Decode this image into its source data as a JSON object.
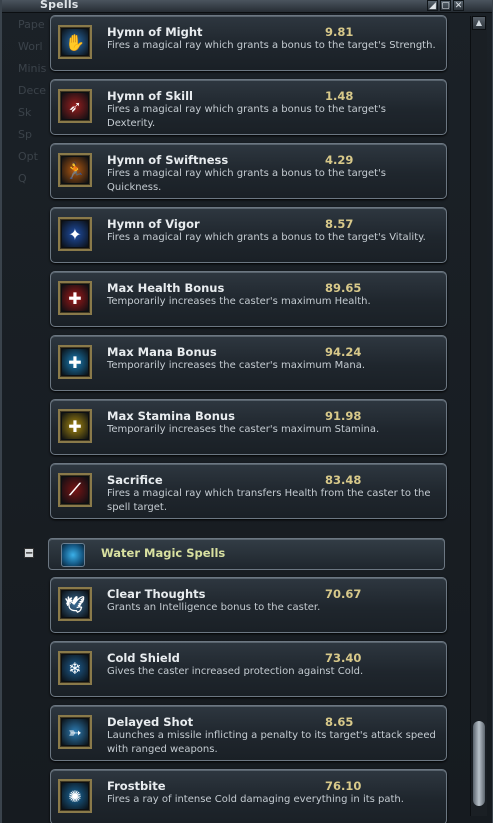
{
  "window": {
    "title": "Spells",
    "buttons": [
      "◢",
      "▢",
      "✕"
    ]
  },
  "background_panel": {
    "items": [
      "Pape",
      "Worl",
      "Minis",
      "Dece",
      "Sk",
      "Sp",
      "Opt",
      "Q"
    ]
  },
  "spells_top": [
    {
      "name": "Hymn of Might",
      "value": "9.81",
      "desc": "Fires a magical ray which grants a bonus to the target's Strength.",
      "icon": "might-icon",
      "icon_color": "#2a6fb0"
    },
    {
      "name": "Hymn of Skill",
      "value": "1.48",
      "desc": "Fires a magical ray which grants a bonus to the target's Dexterity.",
      "icon": "skill-icon",
      "icon_color": "#9a1f1f"
    },
    {
      "name": "Hymn of Swiftness",
      "value": "4.29",
      "desc": "Fires a magical ray which grants a bonus to the target's Quickness.",
      "icon": "swiftness-icon",
      "icon_color": "#b55a12"
    },
    {
      "name": "Hymn of Vigor",
      "value": "8.57",
      "desc": "Fires a magical ray which grants a bonus to the target's Vitality.",
      "icon": "vigor-icon",
      "icon_color": "#1f4fa8"
    },
    {
      "name": "Max Health Bonus",
      "value": "89.65",
      "desc": "Temporarily increases the caster's maximum Health.",
      "icon": "health-icon",
      "icon_color": "#a31818"
    },
    {
      "name": "Max Mana Bonus",
      "value": "94.24",
      "desc": "Temporarily increases the caster's maximum Mana.",
      "icon": "mana-icon",
      "icon_color": "#1a7fb8"
    },
    {
      "name": "Max Stamina Bonus",
      "value": "91.98",
      "desc": "Temporarily increases the caster's maximum Stamina.",
      "icon": "stamina-icon",
      "icon_color": "#a88a10"
    },
    {
      "name": "Sacrifice",
      "value": "83.48",
      "desc": "Fires a magical ray which transfers Health from the caster to the spell target.",
      "icon": "sacrifice-icon",
      "icon_color": "#7a1515"
    }
  ],
  "section": {
    "collapse_symbol": "−",
    "label": "Water Magic Spells"
  },
  "spells_water": [
    {
      "name": "Clear Thoughts",
      "value": "70.67",
      "desc": "Grants an Intelligence bonus to the caster.",
      "icon": "clear-thoughts-icon",
      "icon_color": "#3b6f99"
    },
    {
      "name": "Cold Shield",
      "value": "73.40",
      "desc": "Gives the caster increased protection against Cold.",
      "icon": "cold-shield-icon",
      "icon_color": "#1e5f93"
    },
    {
      "name": "Delayed Shot",
      "value": "8.65",
      "desc": "Launches a missile inflicting a penalty to its target's attack speed with ranged weapons.",
      "icon": "delayed-shot-icon",
      "icon_color": "#2d7db5"
    },
    {
      "name": "Frostbite",
      "value": "76.10",
      "desc": "Fires a ray of intense Cold damaging everything in its path.",
      "icon": "frostbite-icon",
      "icon_color": "#1a6aa0"
    }
  ],
  "scrollbar": {
    "up_arrow": "▲"
  },
  "icon_glyphs": {
    "might-icon": "✋",
    "skill-icon": "➶",
    "swiftness-icon": "🏃",
    "vigor-icon": "✦",
    "health-icon": "✚",
    "mana-icon": "✚",
    "stamina-icon": "✚",
    "sacrifice-icon": "⟋",
    "clear-thoughts-icon": "🕊",
    "cold-shield-icon": "❄",
    "delayed-shot-icon": "➳",
    "frostbite-icon": "✺"
  }
}
